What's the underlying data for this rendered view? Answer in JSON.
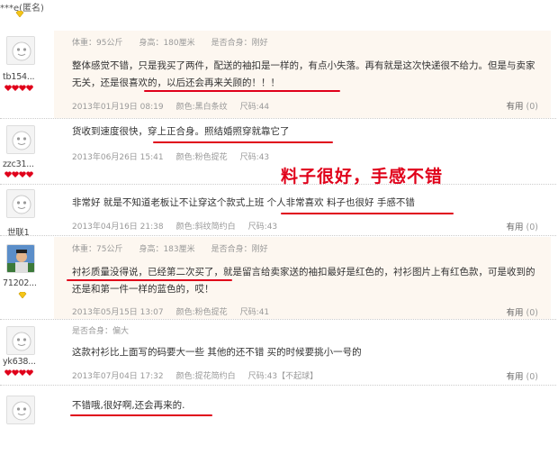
{
  "top_user": "***e(匿名)",
  "reviews": [
    {
      "username": "tb154...",
      "meta": [
        "体重：95公斤",
        "身高：180厘米",
        "是否合身：刚好"
      ],
      "text": "整体感觉不错，只是我买了两件，配送的袖扣是一样的，有点小失落。再有就是这次快递很不给力。但是与卖家无关，还是很喜欢的，以后还会再来关顾的！！！",
      "date": "2013年01月19日 08:19",
      "color": "颜色:黑白条纹",
      "size": "尺码:44",
      "useful_label": "有用",
      "useful_count": "(0)"
    },
    {
      "username": "zzc31...",
      "meta": [],
      "text": "货收到速度很快，穿上正合身。照结婚照穿就靠它了",
      "date": "2013年06月26日 15:41",
      "color": "颜色:粉色提花",
      "size": "尺码:43",
      "useful_label": "有用",
      "useful_count": "(0)"
    },
    {
      "username": "世联1",
      "meta": [],
      "text": "非常好 就是不知道老板让不让穿这个款式上班 个人非常喜欢 料子也很好 手感不错",
      "date": "2013年04月16日 21:38",
      "color": "颜色:斜纹简约白",
      "size": "尺码:43",
      "useful_label": "有用",
      "useful_count": "(0)"
    },
    {
      "username": "71202...",
      "meta": [
        "体重：75公斤",
        "身高：183厘米",
        "是否合身：刚好"
      ],
      "text": "衬衫质量没得说，已经第二次买了，就是留言给卖家送的袖扣最好是红色的，衬衫图片上有红色款，可是收到的还是和第一件一样的蓝色的，哎！",
      "date": "2013年05月15日 13:07",
      "color": "颜色:粉色提花",
      "size": "尺码:41",
      "useful_label": "有用",
      "useful_count": "(0)"
    },
    {
      "username": "yk638...",
      "meta": [
        "是否合身：偏大"
      ],
      "text": "这款衬衫比上面写的码要大一些 其他的还不错 买的时候要挑小一号的",
      "date": "2013年07月04日 17:32",
      "color": "颜色:提花简约白",
      "size": "尺码:43【不起球】",
      "useful_label": "有用",
      "useful_count": "(0)"
    },
    {
      "username": "",
      "meta": [],
      "text": "不错哦,很好啊,还会再来的.",
      "date": "",
      "color": "",
      "size": "",
      "useful_label": "",
      "useful_count": ""
    }
  ],
  "annotation": "料子很好，手感不错",
  "colors": {
    "underline": "#e0001a",
    "shade": "#fdf7f0",
    "rank_heart": "#e0001a"
  }
}
